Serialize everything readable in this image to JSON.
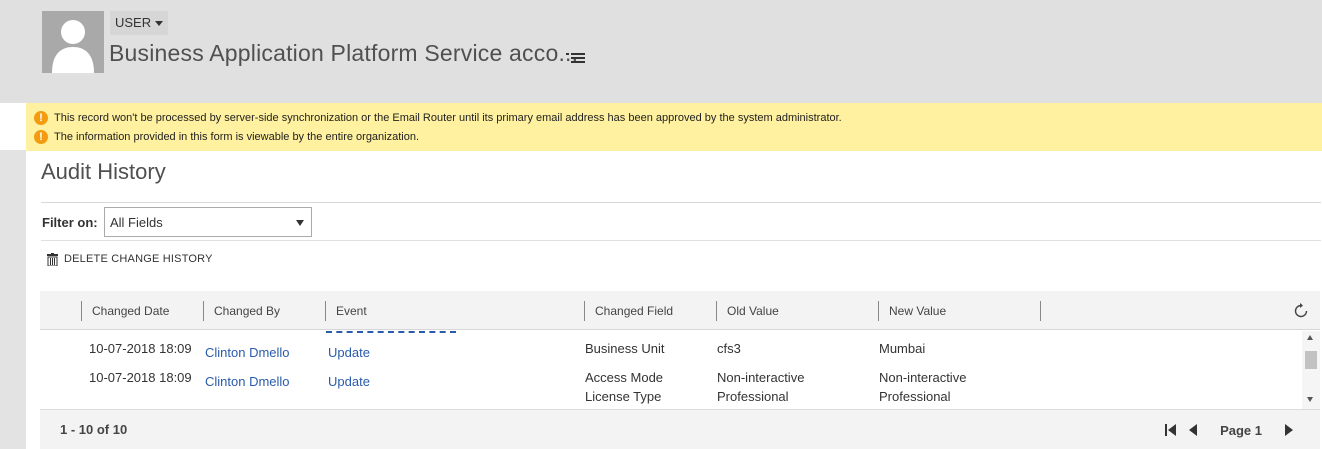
{
  "header": {
    "entity_label": "USER",
    "record_title": "Business Application Platform Service acco..."
  },
  "notifications": [
    {
      "icon": "warning-icon",
      "text": "This record won't be processed by server-side synchronization or the Email Router until its primary email address has been approved by the system administrator."
    },
    {
      "icon": "warning-icon",
      "text": "The information provided in this form is viewable by the entire organization."
    }
  ],
  "audit": {
    "title": "Audit History",
    "filter_label": "Filter on:",
    "filter_value": "All Fields",
    "delete_label": "DELETE CHANGE HISTORY"
  },
  "grid": {
    "columns": [
      "Changed Date",
      "Changed By",
      "Event",
      "Changed Field",
      "Old Value",
      "New Value"
    ],
    "rows": [
      {
        "date": "10-07-2018 18:09",
        "by": "Clinton Dmello",
        "event": "Update",
        "field": "Business Unit",
        "field2": "",
        "old": "cfs3",
        "old2": "",
        "new": "Mumbai",
        "new2": ""
      },
      {
        "date": "10-07-2018 18:09",
        "by": "Clinton Dmello",
        "event": "Update",
        "field": "Access Mode",
        "field2": "License Type",
        "old": "Non-interactive",
        "old2": "Professional",
        "new": "Non-interactive",
        "new2": "Professional"
      }
    ],
    "record_count": "1 - 10 of 10",
    "page_label": "Page 1"
  },
  "colors": {
    "header_bg": "#e0e0e0",
    "notify_bg": "#fff19f",
    "warning": "#f39c12",
    "link": "#2a5caa"
  }
}
